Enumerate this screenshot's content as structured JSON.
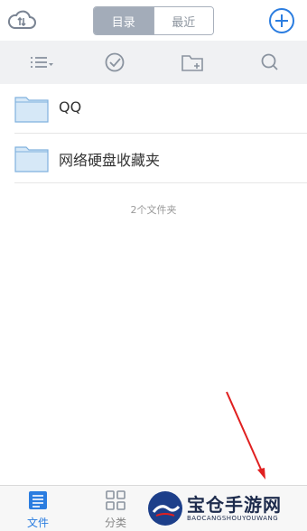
{
  "header": {
    "tabs": [
      {
        "label": "目录",
        "active": true
      },
      {
        "label": "最近",
        "active": false
      }
    ]
  },
  "toolbar": {
    "icons": [
      "list-sort-icon",
      "check-circle-icon",
      "folder-add-icon",
      "search-icon"
    ]
  },
  "files": {
    "items": [
      {
        "name": "QQ",
        "icon": "folder-icon"
      },
      {
        "name": "网络硬盘收藏夹",
        "icon": "folder-icon"
      }
    ],
    "count_text": "2个文件夹"
  },
  "tabbar": {
    "items": [
      {
        "label": "文件",
        "icon": "file-list-icon",
        "active": true
      },
      {
        "label": "分类",
        "icon": "grid-icon",
        "active": false
      }
    ]
  },
  "watermark": {
    "title": "宝仓手游网",
    "subtitle": "BAOCANGSHOUYOUWANG"
  },
  "colors": {
    "accent": "#2b7de0",
    "folder": "#d6e8f7",
    "arrow": "#e02020"
  }
}
